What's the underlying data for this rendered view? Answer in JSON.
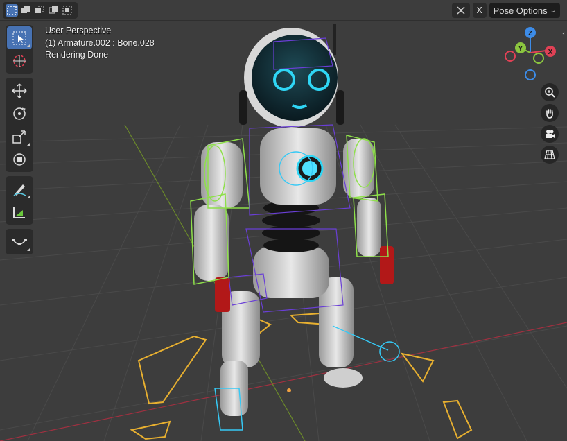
{
  "header": {
    "select_modes": [
      "select-new-icon",
      "select-extend-icon",
      "select-subtract-icon",
      "select-difference-icon",
      "select-intersect-icon"
    ],
    "overlay_toggle_icon": "bone-overlay-icon",
    "x_mirror_label": "X",
    "pose_options_label": "Pose Options"
  },
  "overlay": {
    "view_name": "User Perspective",
    "active_object": "(1) Armature.002 : Bone.028",
    "render_status": "Rendering Done"
  },
  "toolbar": {
    "tools": [
      "select-box-icon",
      "cursor-icon",
      "move-icon",
      "rotate-icon",
      "scale-icon",
      "transform-icon",
      "annotate-icon",
      "measure-icon",
      "pose-relax-icon"
    ]
  },
  "gizmo": {
    "axis_z": "Z",
    "axis_y": "Y",
    "axis_x": "X",
    "colors": {
      "x": "#e04155",
      "y": "#8bc53f",
      "z": "#3d8ce8"
    }
  },
  "navigation": [
    "zoom-icon",
    "pan-hand-icon",
    "camera-view-icon",
    "perspective-grid-icon"
  ]
}
